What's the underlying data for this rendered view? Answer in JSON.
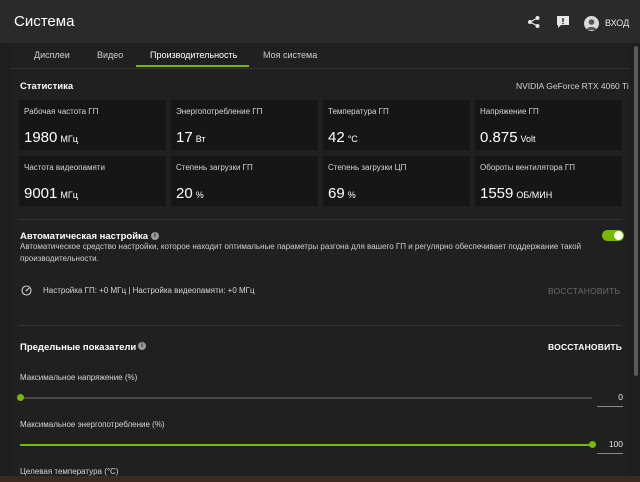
{
  "header": {
    "title": "Система",
    "login_label": "ВХОД",
    "icons": [
      "share-icon",
      "feedback-icon",
      "user-avatar-icon"
    ]
  },
  "tabs": [
    {
      "label": "Дисплеи",
      "active": false
    },
    {
      "label": "Видео",
      "active": false
    },
    {
      "label": "Производительность",
      "active": true
    },
    {
      "label": "Моя система",
      "active": false
    }
  ],
  "stats": {
    "title": "Статистика",
    "gpu_name": "NVIDIA GeForce RTX 4060 Ti",
    "cards": [
      {
        "label": "Рабочая частота ГП",
        "value": "1980",
        "unit": "МГц"
      },
      {
        "label": "Энергопотребление ГП",
        "value": "17",
        "unit": "Вт"
      },
      {
        "label": "Температура ГП",
        "value": "42",
        "unit": "°C"
      },
      {
        "label": "Напряжение ГП",
        "value": "0.875",
        "unit": "Volt"
      },
      {
        "label": "Частота видеопамяти",
        "value": "9001",
        "unit": "МГц"
      },
      {
        "label": "Степень загрузки ГП",
        "value": "20",
        "unit": "%"
      },
      {
        "label": "Степень загрузки ЦП",
        "value": "69",
        "unit": "%"
      },
      {
        "label": "Обороты вентилятора ГП",
        "value": "1559",
        "unit": "ОБ/МИН"
      }
    ]
  },
  "auto_tune": {
    "title": "Автоматическая настройка",
    "enabled": true,
    "description": "Автоматическое средство настройки, которое находит оптимальные параметры разгона для вашего ГП и регулярно обеспечивает поддержание такой производительности.",
    "overclock_status": "Настройка ГП: +0 МГц  |  Настройка видеопамяти: +0 МГц",
    "restore_label": "ВОССТАНОВИТЬ"
  },
  "limits": {
    "title": "Предельные показатели",
    "restore_label": "ВОССТАНОВИТЬ",
    "sliders": [
      {
        "label": "Максимальное напряжение (%)",
        "value": "0",
        "fraction": 0.0
      },
      {
        "label": "Максимальное энергопотребление (%)",
        "value": "100",
        "fraction": 1.0
      },
      {
        "label": "Целевая температура (°C)"
      }
    ]
  },
  "colors": {
    "accent": "#76b900",
    "background": "#202020",
    "card": "#161616"
  }
}
